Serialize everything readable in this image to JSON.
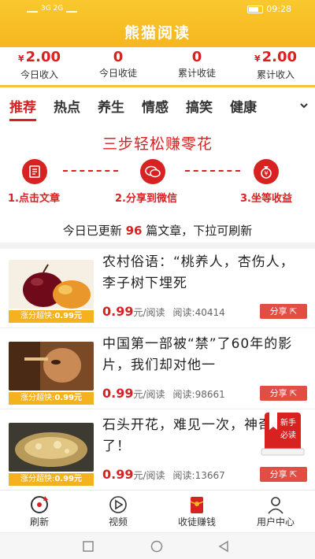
{
  "status_bar": {
    "left_text": "3G 2G",
    "time": "09:28"
  },
  "app_title": "熊猫阅读",
  "stats": [
    {
      "value": "2.00",
      "currency": "¥",
      "label": "今日收入"
    },
    {
      "value": "0",
      "currency": "",
      "label": "今日收徒"
    },
    {
      "value": "0",
      "currency": "",
      "label": "累计收徒"
    },
    {
      "value": "2.00",
      "currency": "¥",
      "label": "累计收入"
    }
  ],
  "tabs": [
    "推荐",
    "热点",
    "养生",
    "情感",
    "搞笑",
    "健康"
  ],
  "promo_title": "三步轻松赚零花",
  "steps": [
    "1.点击文章",
    "2.分享到微信",
    "3.坐等收益"
  ],
  "update": {
    "prefix": "今日已更新",
    "count": "96",
    "suffix": "篇文章，下拉可刷新"
  },
  "articles": [
    {
      "title": "农村俗语：“桃养人，杏伤人，李子树下埋死",
      "price": "0.99",
      "price_unit": "元/阅读",
      "reads": "阅读:40414",
      "badge_prefix": "涨分超快:",
      "badge_value": "0.99元",
      "share": "分享"
    },
    {
      "title": "中国第一部被“禁”了60年的影片，我们却对他一",
      "price": "0.99",
      "price_unit": "元/阅读",
      "reads": "阅读:98661",
      "badge_prefix": "涨分超快:",
      "badge_value": "0.99元",
      "share": "分享"
    },
    {
      "title": "石头开花，难见一次，神奇了！",
      "price": "0.99",
      "price_unit": "元/阅读",
      "reads": "阅读:13667",
      "badge_prefix": "涨分超快:",
      "badge_value": "0.99元",
      "share": "分享"
    }
  ],
  "novice_badge": {
    "line1": "新手",
    "line2": "必读"
  },
  "bottom_nav": [
    {
      "label": "刷新",
      "icon": "refresh-icon"
    },
    {
      "label": "视频",
      "icon": "play-icon"
    },
    {
      "label": "收徒赚钱",
      "icon": "red-envelope-icon"
    },
    {
      "label": "用户中心",
      "icon": "user-icon"
    }
  ],
  "colors": {
    "brand_yellow": "#f6b61f",
    "accent_red": "#d82222"
  }
}
